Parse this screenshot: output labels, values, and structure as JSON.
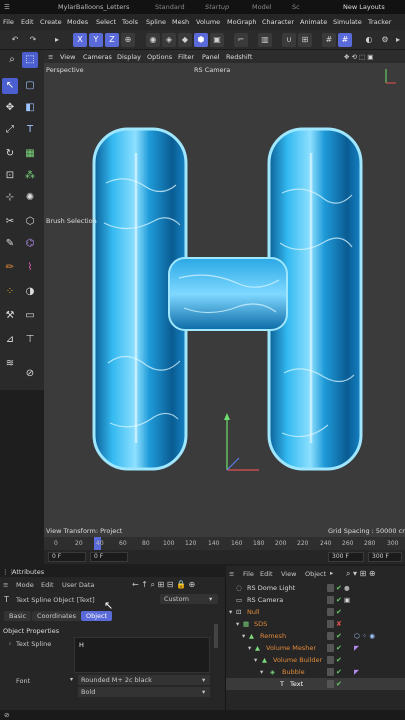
{
  "titlebar": {
    "file": "MylarBalloons_Letters",
    "layout1": "Standard",
    "layout2": "Startup",
    "layout3": "Model",
    "layout4": "Sc",
    "new_layouts": "New Layouts"
  },
  "menu": [
    "File",
    "Edit",
    "Create",
    "Modes",
    "Select",
    "Tools",
    "Spline",
    "Mesh",
    "Volume",
    "MoGraph",
    "Character",
    "Animate",
    "Simulate",
    "Tracker"
  ],
  "toolbar": {
    "axis_x": "X",
    "axis_y": "Y",
    "axis_z": "Z"
  },
  "viewport_menu": [
    "View",
    "Cameras",
    "Display",
    "Options",
    "Filter",
    "Panel",
    "Redshift"
  ],
  "viewport": {
    "perspective": "Perspective",
    "camera": "RS Camera",
    "tool_hint": "Brush Selection",
    "view_transform": "View Transform: Project",
    "grid_spacing": "Grid Spacing : 50000 cm"
  },
  "timeline": {
    "ticks": [
      "0",
      "20",
      "40",
      "60",
      "80",
      "100",
      "120",
      "140",
      "160",
      "180",
      "200",
      "220",
      "240",
      "260",
      "280",
      "300"
    ],
    "start_frame": "0 F",
    "current_frame": "0 F",
    "end_frame": "300 F",
    "max_frame": "300 F"
  },
  "attributes": {
    "title": "Attributes",
    "menu": [
      "Mode",
      "Edit",
      "User Data"
    ],
    "object_name": "Text Spline Object [Text]",
    "preset": "Custom",
    "tabs": [
      "Basic",
      "Coordinates",
      "Object"
    ],
    "section": "Object Properties",
    "text_label": "Text Spline",
    "text_value": "H",
    "font_label": "Font",
    "font_name": "Rounded M+ 2c black",
    "font_weight": "Bold"
  },
  "object_manager": {
    "menu": [
      "File",
      "Edit",
      "View",
      "Object"
    ],
    "items": [
      {
        "name": "RS Dome Light",
        "color": "#d8d8d8"
      },
      {
        "name": "RS Camera",
        "color": "#d8d8d8"
      },
      {
        "name": "Null",
        "color": "#e08a3a"
      },
      {
        "name": "SDS",
        "color": "#e08a3a"
      },
      {
        "name": "Remesh",
        "color": "#e08a3a"
      },
      {
        "name": "Volume Mesher",
        "color": "#e08a3a"
      },
      {
        "name": "Volume Builder",
        "color": "#e08a3a"
      },
      {
        "name": "Bubble",
        "color": "#e08a3a"
      },
      {
        "name": "Text",
        "color": "#ffffff"
      }
    ]
  },
  "colors": {
    "accent": "#5a6ad8",
    "balloon": "#2aa8e6"
  }
}
